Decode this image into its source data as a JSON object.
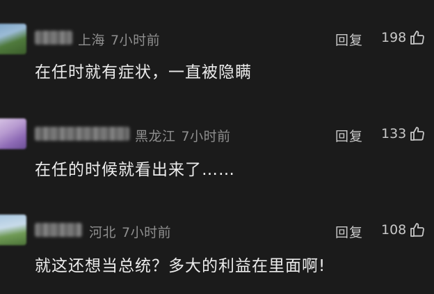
{
  "comments": [
    {
      "location": "上海",
      "time": "7小时前",
      "text": "在任时就有症状，一直被隐瞒",
      "reply_label": "回复",
      "likes": "198"
    },
    {
      "location": "黑龙江",
      "time": "7小时前",
      "text": "在任的时候就看出来了……",
      "reply_label": "回复",
      "likes": "133"
    },
    {
      "location": "河北",
      "time": "7小时前",
      "text": "就这还想当总统？多大的利益在里面啊!",
      "reply_label": "回复",
      "likes": "108"
    }
  ],
  "icons": {
    "like": "thumbs-up-icon"
  },
  "colors": {
    "background": "#1b1b1b",
    "meta_text": "#8f8f8f",
    "body_text": "#ececec"
  }
}
